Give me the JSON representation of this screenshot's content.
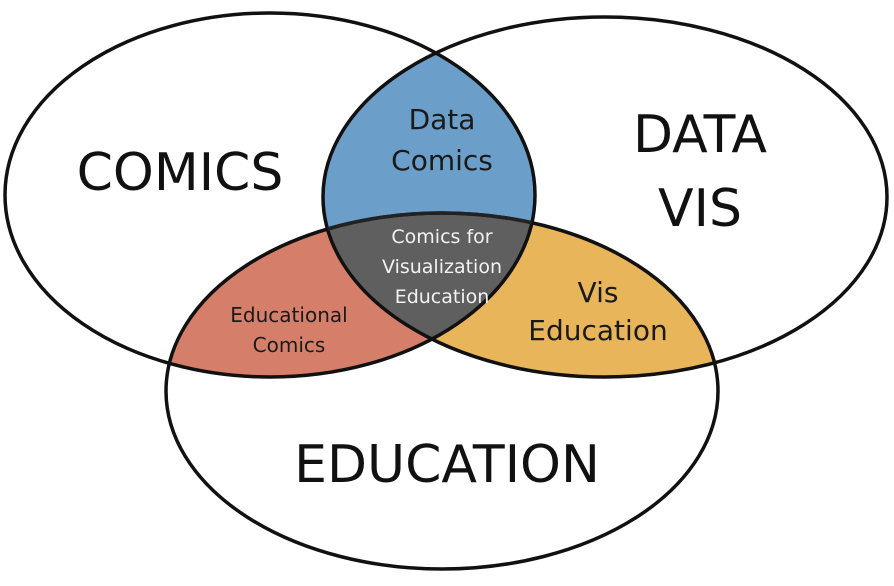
{
  "sets": {
    "comics": "COMICS",
    "data_vis_line1": "DATA",
    "data_vis_line2": "VIS",
    "education": "EDUCATION"
  },
  "intersections": {
    "data_comics_line1": "Data",
    "data_comics_line2": "Comics",
    "educational_comics_line1": "Educational",
    "educational_comics_line2": "Comics",
    "vis_education_line1": "Vis",
    "vis_education_line2": "Education",
    "center_line1": "Comics for",
    "center_line2": "Visualization",
    "center_line3": "Education"
  },
  "colors": {
    "data_comics": "#6b9ec8",
    "educational_comics": "#d57f6a",
    "vis_education": "#e8b55a",
    "center": "#5f5f5f",
    "outline": "#111111"
  }
}
